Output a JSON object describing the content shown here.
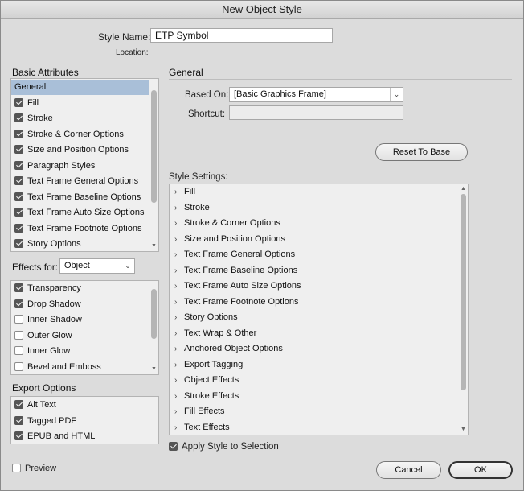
{
  "window": {
    "title": "New Object Style"
  },
  "style_name": {
    "label": "Style Name:",
    "value": "ETP Symbol"
  },
  "location": {
    "label": "Location:"
  },
  "basic_attributes": {
    "heading": "Basic Attributes",
    "items": [
      {
        "label": "General",
        "checkbox": null,
        "selected": true
      },
      {
        "label": "Fill",
        "checkbox": true
      },
      {
        "label": "Stroke",
        "checkbox": true
      },
      {
        "label": "Stroke & Corner Options",
        "checkbox": true
      },
      {
        "label": "Size and Position Options",
        "checkbox": true
      },
      {
        "label": "Paragraph Styles",
        "checkbox": true
      },
      {
        "label": "Text Frame General Options",
        "checkbox": true
      },
      {
        "label": "Text Frame Baseline Options",
        "checkbox": true
      },
      {
        "label": "Text Frame Auto Size Options",
        "checkbox": true
      },
      {
        "label": "Text Frame Footnote Options",
        "checkbox": true
      },
      {
        "label": "Story Options",
        "checkbox": true
      }
    ]
  },
  "effects_for": {
    "label": "Effects for:",
    "selected": "Object",
    "items": [
      {
        "label": "Transparency",
        "checkbox": true
      },
      {
        "label": "Drop Shadow",
        "checkbox": true
      },
      {
        "label": "Inner Shadow",
        "checkbox": false
      },
      {
        "label": "Outer Glow",
        "checkbox": false
      },
      {
        "label": "Inner Glow",
        "checkbox": false
      },
      {
        "label": "Bevel and Emboss",
        "checkbox": false
      }
    ]
  },
  "export_options": {
    "heading": "Export Options",
    "items": [
      {
        "label": "Alt Text",
        "checkbox": true
      },
      {
        "label": "Tagged PDF",
        "checkbox": true
      },
      {
        "label": "EPUB and HTML",
        "checkbox": true
      }
    ]
  },
  "preview": {
    "label": "Preview",
    "checked": false
  },
  "general_panel": {
    "heading": "General",
    "based_on": {
      "label": "Based On:",
      "value": "[Basic Graphics Frame]"
    },
    "shortcut": {
      "label": "Shortcut:",
      "value": ""
    },
    "reset_button": "Reset To Base",
    "style_settings": {
      "label": "Style Settings:",
      "items": [
        "Fill",
        "Stroke",
        "Stroke & Corner Options",
        "Size and Position Options",
        "Text Frame General Options",
        "Text Frame Baseline Options",
        "Text Frame Auto Size Options",
        "Text Frame Footnote Options",
        "Story Options",
        "Text Wrap & Other",
        "Anchored Object Options",
        "Export Tagging",
        "Object Effects",
        "Stroke Effects",
        "Fill Effects",
        "Text Effects"
      ]
    },
    "apply_style": {
      "label": "Apply Style to Selection",
      "checked": true
    }
  },
  "buttons": {
    "cancel": "Cancel",
    "ok": "OK"
  },
  "icons": {
    "expand": "chevron-right-icon",
    "dropdown": "chevron-down-icon"
  },
  "colors": {
    "selection": "#a9bfd8",
    "dialog_bg": "#dcdcdc"
  }
}
